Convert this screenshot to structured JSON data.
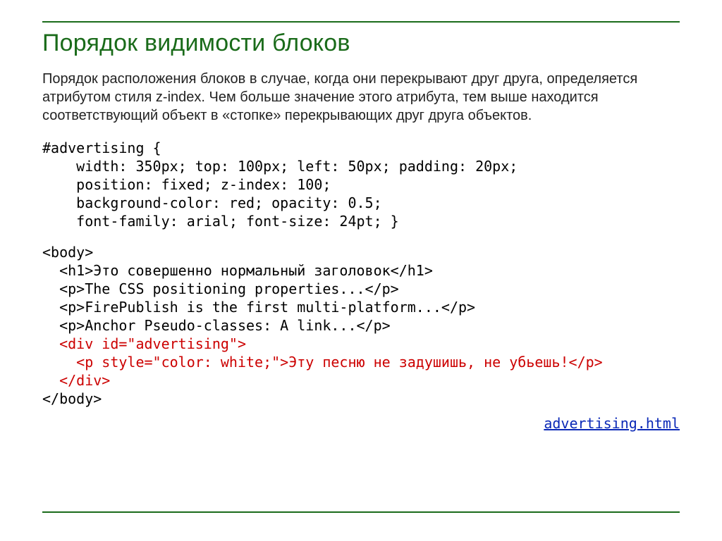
{
  "title": "Порядок видимости блоков",
  "paragraph": "Порядок расположения блоков в случае, когда они перекрывают друг друга, определяется атрибутом стиля z-index. Чем больше значение этого атрибута, тем выше находится соответствующий объект в «стопке» перекрывающих друг друга объектов.",
  "css_code": "#advertising {\n    width: 350px; top: 100px; left: 50px; padding: 20px;\n    position: fixed; z-index: 100;\n    background-color: red; opacity: 0.5;\n    font-family: arial; font-size: 24pt; }",
  "html_example": {
    "l1": "<body>",
    "l2": "  <h1>Это совершенно нормальный заголовок</h1>",
    "l3": "  <p>The CSS positioning properties...</p>",
    "l4": "  <p>FirePublish is the first multi-platform...</p>",
    "l5": "  <p>Anchor Pseudo-classes: A link...</p>",
    "r1": "  <div id=\"advertising\">",
    "r2": "    <p style=\"color: white;\">Эту песню не задушишь, не убьешь!</p>",
    "r3": "  </div>",
    "l6": "</body>"
  },
  "link_text": "advertising.html"
}
